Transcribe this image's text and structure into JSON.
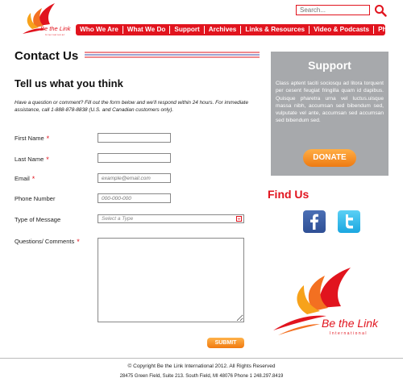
{
  "header": {
    "search_placeholder": "Search...",
    "nav": [
      "Who We Are",
      "What We Do",
      "Support",
      "Archives",
      "Links & Resources",
      "Video & Podcasts",
      "Photos"
    ],
    "logo_text_be": "Be the Link",
    "logo_text_sub": "International"
  },
  "main": {
    "title": "Contact Us",
    "subtitle": "Tell us what you think",
    "intro": "Have a question or comment? Fill out the form below and we'll respond within 24 hours. For immediate assistance, call 1-888-878-8838 (U.S. and Canadian customers only).",
    "form": {
      "first_name": "First Name",
      "last_name": "Last Name",
      "email": "Email",
      "email_placeholder": "example@email.com",
      "phone": "Phone Number",
      "phone_placeholder": "000-000-000",
      "type": "Type of Message",
      "type_placeholder": "Select a Type",
      "questions": "Questions/ Comments",
      "required_mark": "*",
      "submit": "SUBMIT"
    }
  },
  "sidebar": {
    "support_title": "Support",
    "support_body": "Class aptent taciti sociosqu ad litora torquent per cesent feugiat fringilla quam id dapibus. Quisque pharetra urna vel luctus.uisque massa nibh, accumsan sed bibendum sed, vulputate vel ante, accumsan sed accumsan sed bibendum sed.",
    "donate": "DONATE",
    "find_us": "Find Us"
  },
  "footer": {
    "copyright": "© Copyright   Be the Link International 2012. All Rights Reserved",
    "address": "28475 Green Field, Suite 213. South Field, MI 48076 Phone 1 248.297.8419"
  },
  "colors": {
    "brand_red": "#e1141e",
    "orange": "#f07a10",
    "panel_gray": "#a7a9ac"
  }
}
